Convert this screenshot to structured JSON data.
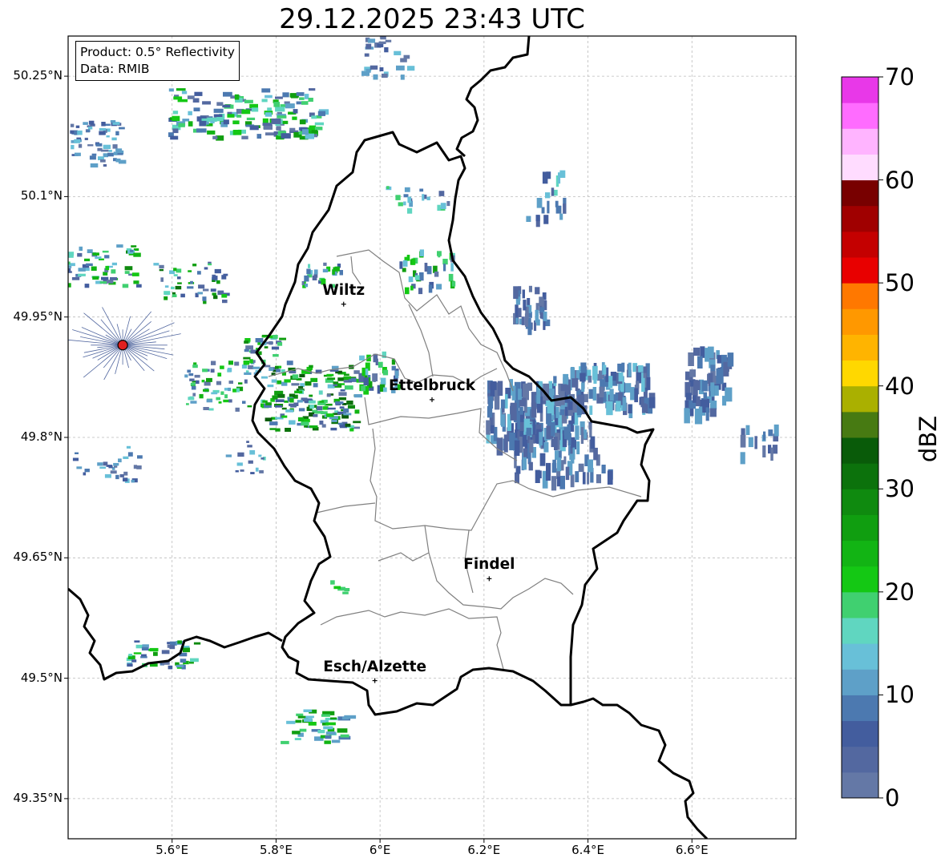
{
  "title": "29.12.2025 23:43 UTC",
  "info": {
    "product": "Product: 0.5° Reflectivity",
    "source": "Data: RMIB"
  },
  "map": {
    "lon_range": [
      5.4,
      6.8
    ],
    "lat_range": [
      49.3,
      50.3
    ],
    "gridlines": true,
    "lat_labels": [
      "50.25°N",
      "50.1°N",
      "49.95°N",
      "49.8°N",
      "49.65°N",
      "49.5°N",
      "49.35°N"
    ],
    "lon_labels": [
      "5.6°E",
      "5.8°E",
      "6°E",
      "6.2°E",
      "6.4°E",
      "6.6°E"
    ],
    "radar_site": {
      "lon": 5.505,
      "lat": 49.915,
      "color": "#e02020"
    },
    "cities": [
      {
        "name": "Wiltz",
        "lon": 5.93,
        "lat": 49.966
      },
      {
        "name": "Ettelbruck",
        "lon": 6.1,
        "lat": 49.847
      },
      {
        "name": "Findel",
        "lon": 6.21,
        "lat": 49.624
      },
      {
        "name": "Esch/Alzette",
        "lon": 5.99,
        "lat": 49.497
      }
    ]
  },
  "colorbar": {
    "label": "dBZ",
    "min": 0,
    "max": 70,
    "ticks": [
      "0",
      "10",
      "20",
      "30",
      "40",
      "50",
      "60",
      "70"
    ],
    "colors": [
      "#6478a6",
      "#5368a0",
      "#435d9e",
      "#4c79b0",
      "#5ea0c8",
      "#68c0d8",
      "#60d6c0",
      "#40d070",
      "#14c814",
      "#12b414",
      "#109e10",
      "#0f8a0f",
      "#0c720c",
      "#095b09",
      "#477a12",
      "#aab000",
      "#ffd800",
      "#ffb400",
      "#ff9800",
      "#ff7800",
      "#e80000",
      "#c40000",
      "#a00000",
      "#780000",
      "#ffdcff",
      "#ffb4ff",
      "#ff6cff",
      "#e838e8"
    ]
  }
}
